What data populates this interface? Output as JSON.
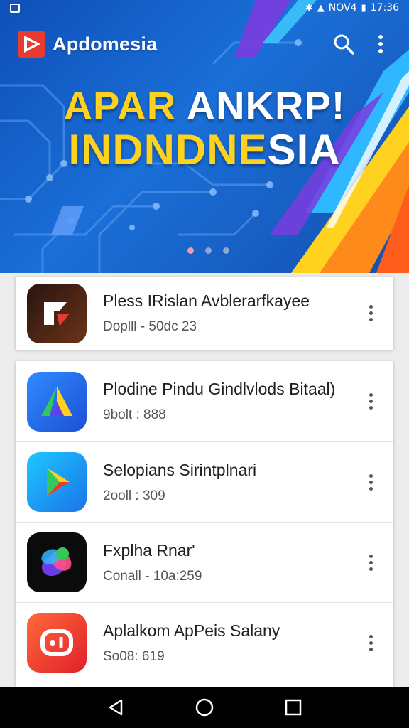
{
  "status_bar": {
    "network_label": "NOV4",
    "time": "17:36",
    "signal_glyph": "▲",
    "battery_glyph": "▮"
  },
  "app_bar": {
    "title": "Apdomesia",
    "logo_icon": "play-logo-icon",
    "search_icon": "search-icon",
    "overflow_icon": "more-vert-icon"
  },
  "banner": {
    "line1_part1": "APAR",
    "line1_part2": " ANKRP!",
    "line2_part1": "INDNDNE",
    "line2_part2": "SIA",
    "dots": 3,
    "active_dot": 0
  },
  "featured_app": {
    "name": "Pless IRislan Avblerarfkayee",
    "meta": "Doplll - 50dc 23",
    "icon": "dark-square-logo-icon",
    "menu_icon": "more-vert-icon"
  },
  "apps": [
    {
      "name": "Plodine Pindu Gindlvlods Bitaal)",
      "meta": "9bolt : 888",
      "icon": "triangle-a-icon",
      "menu_icon": "more-vert-icon"
    },
    {
      "name": "Selopians Sirintplnari",
      "meta": "2ooll : 309",
      "icon": "play-store-icon",
      "menu_icon": "more-vert-icon"
    },
    {
      "name": "Fxplha Rnar'",
      "meta": "Conall - 10a:259",
      "icon": "colorful-blob-icon",
      "menu_icon": "more-vert-icon"
    },
    {
      "name": "Aplalkom ApPeis Salany",
      "meta": "So08: 619",
      "icon": "red-ring-icon",
      "menu_icon": "more-vert-icon"
    }
  ],
  "nav_bar": {
    "back_icon": "back-icon",
    "home_icon": "home-icon",
    "recents_icon": "recents-icon"
  },
  "colors": {
    "banner_yellow": "#ffd21f",
    "banner_blue": "#1a6fd8",
    "accent_orange": "#ff8a1c"
  }
}
